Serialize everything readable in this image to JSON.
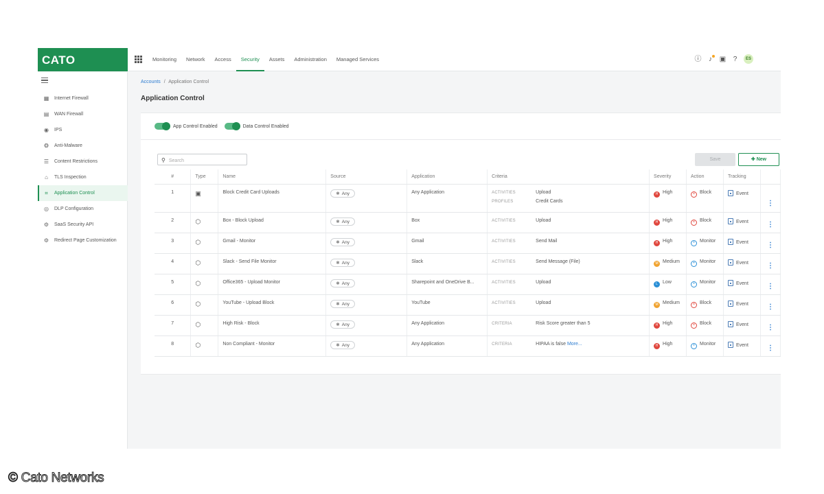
{
  "brand": {
    "logo_text": "CATO",
    "color": "#1e8f52"
  },
  "topnav": {
    "items": [
      {
        "label": "Monitoring",
        "active": false
      },
      {
        "label": "Network",
        "active": false
      },
      {
        "label": "Access",
        "active": false
      },
      {
        "label": "Security",
        "active": true
      },
      {
        "label": "Assets",
        "active": false
      },
      {
        "label": "Administration",
        "active": false
      },
      {
        "label": "Managed Services",
        "active": false
      }
    ],
    "icons": [
      "alert-icon",
      "notification-bell-icon",
      "device-icon",
      "help-icon"
    ],
    "avatar_initials": "ES"
  },
  "sidebar": {
    "items": [
      {
        "label": "Internet Firewall",
        "icon": "firewall-grid-icon",
        "active": false
      },
      {
        "label": "WAN Firewall",
        "icon": "wan-firewall-icon",
        "active": false
      },
      {
        "label": "IPS",
        "icon": "ips-icon",
        "active": false
      },
      {
        "label": "Anti-Malware",
        "icon": "anti-malware-icon",
        "active": false
      },
      {
        "label": "Content Restrictions",
        "icon": "content-list-icon",
        "active": false
      },
      {
        "label": "TLS Inspection",
        "icon": "lock-icon",
        "active": false
      },
      {
        "label": "Application Control",
        "icon": "app-control-icon",
        "active": true
      },
      {
        "label": "DLP Configuration",
        "icon": "dlp-icon",
        "active": false
      },
      {
        "label": "SaaS Security API",
        "icon": "saas-gear-icon",
        "active": false
      },
      {
        "label": "Redirect Page Customization",
        "icon": "redirect-gear-icon",
        "active": false
      }
    ]
  },
  "breadcrumb": {
    "root": "Accounts",
    "separator": "/",
    "current": "Application Control"
  },
  "page_title": "Application Control",
  "toggles": {
    "app_control": {
      "label": "App Control Enabled",
      "on": true
    },
    "data_control": {
      "label": "Data Control Enabled",
      "on": true
    }
  },
  "toolbar": {
    "search_placeholder": "Search",
    "save_label": "Save",
    "new_label": "New"
  },
  "table": {
    "headers": {
      "num": "#",
      "type": "Type",
      "name": "Name",
      "source": "Source",
      "application": "Application",
      "criteria": "Criteria",
      "severity": "Severity",
      "action": "Action",
      "tracking": "Tracking"
    },
    "rows": [
      {
        "num": "1",
        "type": "data-control-icon",
        "name": "Block Credit Card Uploads",
        "source": "Any",
        "application": "Any Application",
        "criteria": [
          {
            "key": "ACTIVITIES",
            "value": "Upload"
          },
          {
            "key": "PROFILES",
            "value": "Credit Cards"
          }
        ],
        "severity": "High",
        "severity_color": "#e0473e",
        "action": "Block",
        "action_color": "#e0473e",
        "tracking": "Event"
      },
      {
        "num": "2",
        "type": "app-control-icon",
        "name": "Box - Block Upload",
        "source": "Any",
        "application": "Box",
        "criteria": [
          {
            "key": "ACTIVITIES",
            "value": "Upload"
          }
        ],
        "severity": "High",
        "severity_color": "#e0473e",
        "action": "Block",
        "action_color": "#e0473e",
        "tracking": "Event"
      },
      {
        "num": "3",
        "type": "app-control-icon",
        "name": "Gmail - Monitor",
        "source": "Any",
        "application": "Gmail",
        "criteria": [
          {
            "key": "ACTIVITIES",
            "value": "Send Mail"
          }
        ],
        "severity": "High",
        "severity_color": "#e0473e",
        "action": "Monitor",
        "action_color": "#2b8fd6",
        "tracking": "Event"
      },
      {
        "num": "4",
        "type": "app-control-icon",
        "name": "Slack - Send File Monitor",
        "source": "Any",
        "application": "Slack",
        "criteria": [
          {
            "key": "ACTIVITIES",
            "value": "Send Message (File)"
          }
        ],
        "severity": "Medium",
        "severity_color": "#f0a330",
        "action": "Monitor",
        "action_color": "#2b8fd6",
        "tracking": "Event"
      },
      {
        "num": "5",
        "type": "app-control-icon",
        "name": "Office365 - Upload Monitor",
        "source": "Any",
        "application": "Sharepoint and OneDrive B...",
        "criteria": [
          {
            "key": "ACTIVITIES",
            "value": "Upload"
          }
        ],
        "severity": "Low",
        "severity_color": "#2b8fd6",
        "action": "Monitor",
        "action_color": "#2b8fd6",
        "tracking": "Event"
      },
      {
        "num": "6",
        "type": "app-control-icon",
        "name": "YouTube - Upload Block",
        "source": "Any",
        "application": "YouTube",
        "criteria": [
          {
            "key": "ACTIVITIES",
            "value": "Upload"
          }
        ],
        "severity": "Medium",
        "severity_color": "#f0a330",
        "action": "Block",
        "action_color": "#e0473e",
        "tracking": "Event"
      },
      {
        "num": "7",
        "type": "app-control-icon",
        "name": "High Risk - Block",
        "source": "Any",
        "application": "Any Application",
        "criteria": [
          {
            "key": "CRITERIA",
            "value": "Risk Score greater than 5"
          }
        ],
        "severity": "High",
        "severity_color": "#e0473e",
        "action": "Block",
        "action_color": "#e0473e",
        "tracking": "Event"
      },
      {
        "num": "8",
        "type": "app-control-icon",
        "name": "Non Compliant - Monitor",
        "source": "Any",
        "application": "Any Application",
        "criteria": [
          {
            "key": "CRITERIA",
            "value": "HIPAA is false",
            "more": "More..."
          }
        ],
        "severity": "High",
        "severity_color": "#e0473e",
        "action": "Monitor",
        "action_color": "#2b8fd6",
        "tracking": "Event"
      }
    ]
  },
  "copyright": "© Cato Networks"
}
